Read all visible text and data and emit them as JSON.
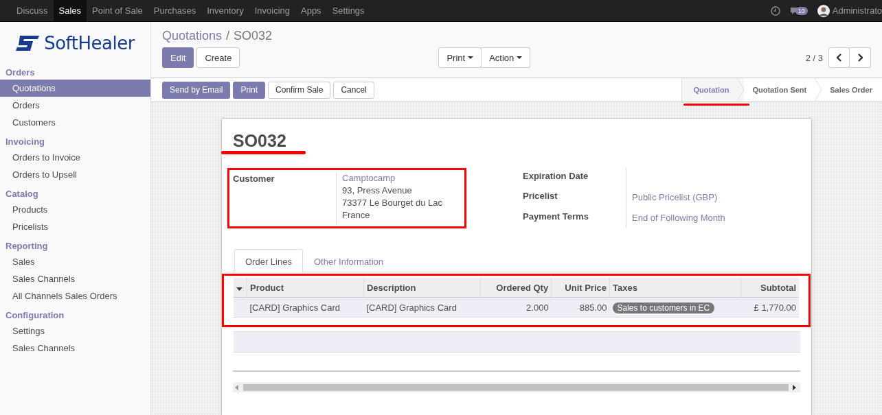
{
  "top_menu": [
    {
      "label": "Discuss",
      "selected": false
    },
    {
      "label": "Sales",
      "selected": true
    },
    {
      "label": "Point of Sale",
      "selected": false
    },
    {
      "label": "Purchases",
      "selected": false
    },
    {
      "label": "Inventory",
      "selected": false
    },
    {
      "label": "Invoicing",
      "selected": false
    },
    {
      "label": "Apps",
      "selected": false
    },
    {
      "label": "Settings",
      "selected": false
    }
  ],
  "systray": {
    "messages_count": "10",
    "user": "Administrato"
  },
  "logo": {
    "text": "SoftHealer"
  },
  "sidebar": [
    {
      "title": "Orders",
      "items": [
        {
          "label": "Quotations",
          "selected": true
        },
        {
          "label": "Orders",
          "selected": false
        },
        {
          "label": "Customers",
          "selected": false
        }
      ]
    },
    {
      "title": "Invoicing",
      "items": [
        {
          "label": "Orders to Invoice",
          "selected": false
        },
        {
          "label": "Orders to Upsell",
          "selected": false
        }
      ]
    },
    {
      "title": "Catalog",
      "items": [
        {
          "label": "Products",
          "selected": false
        },
        {
          "label": "Pricelists",
          "selected": false
        }
      ]
    },
    {
      "title": "Reporting",
      "items": [
        {
          "label": "Sales",
          "selected": false
        },
        {
          "label": "Sales Channels",
          "selected": false
        },
        {
          "label": "All Channels Sales Orders",
          "selected": false
        }
      ]
    },
    {
      "title": "Configuration",
      "items": [
        {
          "label": "Settings",
          "selected": false
        },
        {
          "label": "Sales Channels",
          "selected": false
        }
      ]
    }
  ],
  "breadcrumb": {
    "parent": "Quotations",
    "separator": "/",
    "current": "SO032"
  },
  "control_buttons": [
    {
      "label": "Edit",
      "kind": "primary"
    },
    {
      "label": "Create",
      "kind": "default"
    }
  ],
  "dropdowns": [
    {
      "label": "Print"
    },
    {
      "label": "Action"
    }
  ],
  "pager": {
    "text": "2 / 3"
  },
  "status_buttons": [
    {
      "label": "Send by Email",
      "kind": "primary"
    },
    {
      "label": "Print",
      "kind": "primary"
    },
    {
      "label": "Confirm Sale",
      "kind": "default"
    },
    {
      "label": "Cancel",
      "kind": "default"
    }
  ],
  "stages": [
    {
      "label": "Quotation",
      "selected": true
    },
    {
      "label": "Quotation Sent",
      "selected": false
    },
    {
      "label": "Sales Order",
      "selected": false
    }
  ],
  "form": {
    "title": "SO032",
    "customer": {
      "label": "Customer",
      "name": "Camptocamp",
      "address": [
        "93, Press Avenue",
        "73377 Le Bourget du Lac",
        "France"
      ]
    },
    "fields": [
      {
        "label": "Expiration Date"
      },
      {
        "label": "Pricelist",
        "value": "Public Pricelist (GBP)"
      },
      {
        "label": "Payment Terms",
        "value": "End of Following Month"
      }
    ],
    "tabs": [
      {
        "label": "Order Lines",
        "selected": true
      },
      {
        "label": "Other Information",
        "selected": false
      }
    ],
    "table": {
      "columns": [
        {
          "label": "Product"
        },
        {
          "label": "Description"
        },
        {
          "label": "Ordered Qty"
        },
        {
          "label": "Unit Price"
        },
        {
          "label": "Taxes"
        },
        {
          "label": "Subtotal"
        }
      ],
      "rows": [
        {
          "product": "[CARD] Graphics Card",
          "description": "[CARD] Graphics Card",
          "qty": "2.000",
          "unit_price": "885.00",
          "taxes": "Sales to customers in EC",
          "subtotal": "£ 1,770.00"
        }
      ]
    }
  },
  "highlights": {
    "title_underline": true,
    "stage_underline": true,
    "customer_box": true,
    "order_lines_box": true
  }
}
